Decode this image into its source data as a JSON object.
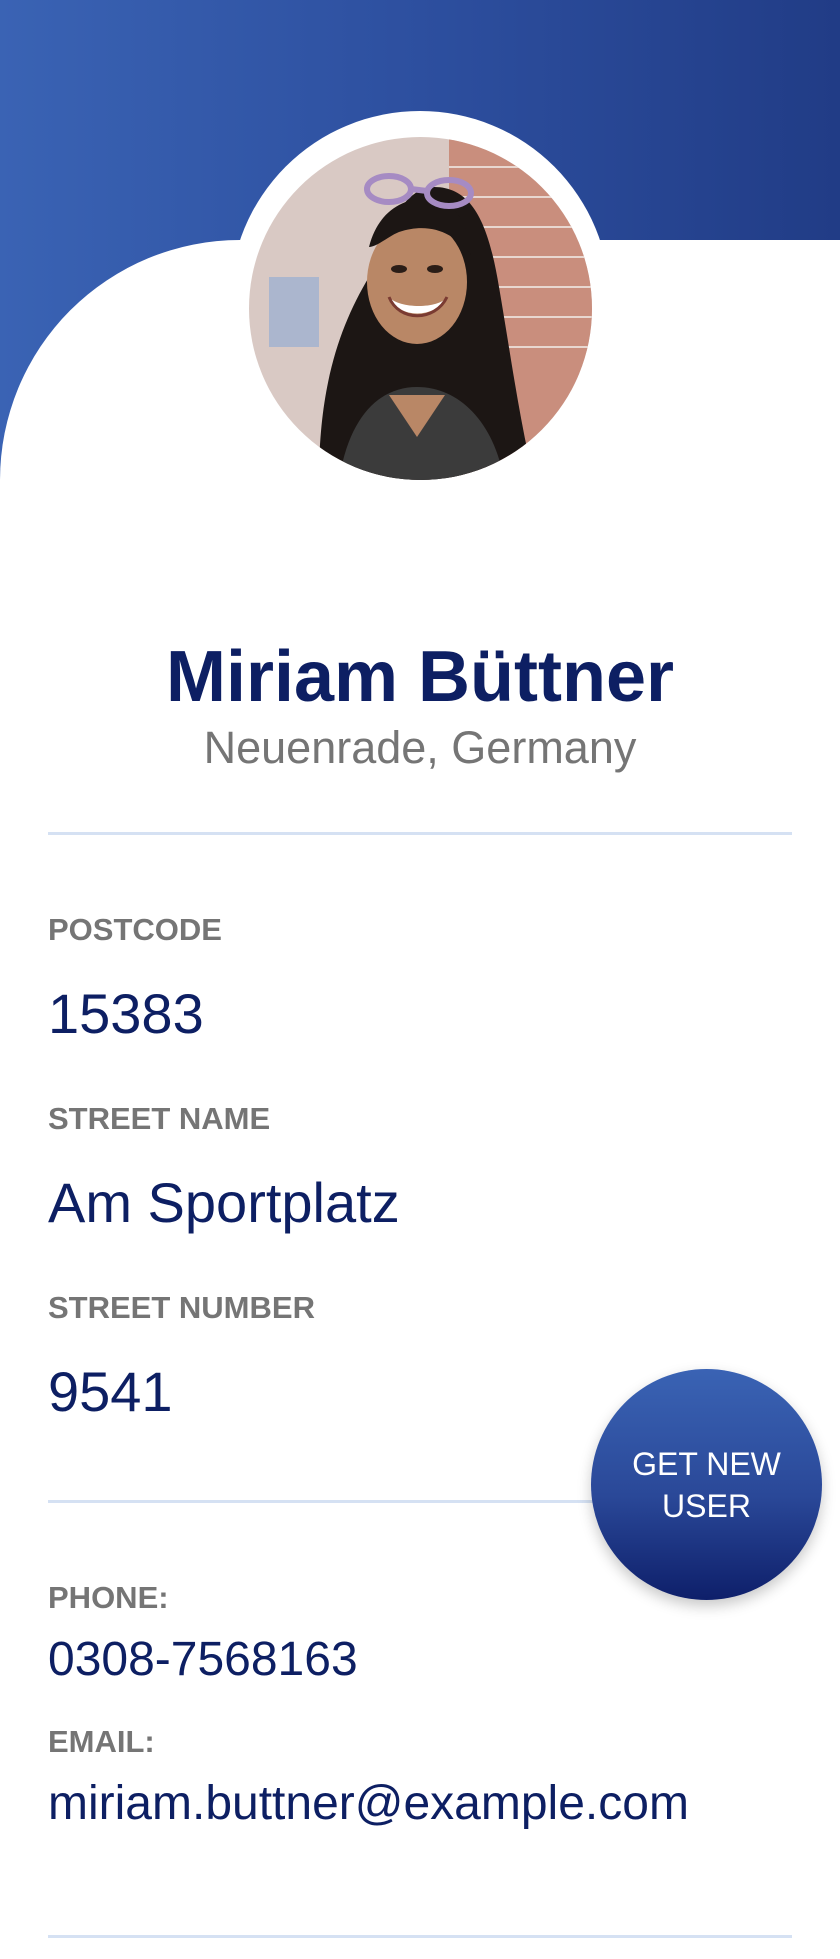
{
  "profile": {
    "name": "Miriam Büttner",
    "location": "Neuenrade, Germany"
  },
  "address": {
    "postcode_label": "POSTCODE",
    "postcode": "15383",
    "street_name_label": "STREET NAME",
    "street_name": "Am Sportplatz",
    "street_number_label": "STREET NUMBER",
    "street_number": "9541"
  },
  "contact": {
    "phone_label": "PHONE:",
    "phone": "0308-7568163",
    "email_label": "EMAIL:",
    "email": "miriam.buttner@example.com"
  },
  "actions": {
    "get_new_user_label": "GET NEW USER"
  },
  "colors": {
    "primary_dark": "#0d1f63",
    "primary": "#2d4f9f",
    "muted_text": "#757575",
    "divider": "#d5e1f3"
  }
}
